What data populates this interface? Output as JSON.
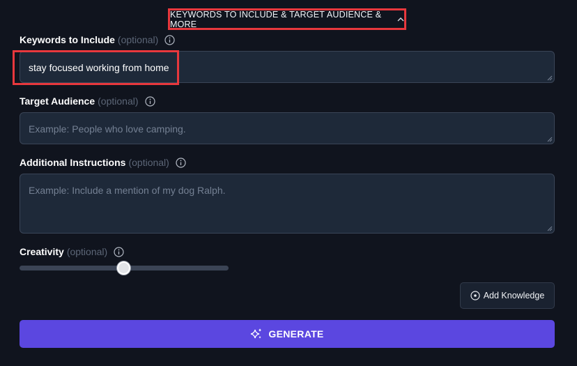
{
  "toggle": {
    "label": "KEYWORDS TO INCLUDE & TARGET AUDIENCE & MORE",
    "icon": "chevron-up-icon"
  },
  "keywords": {
    "label": "Keywords to Include",
    "optional": "(optional)",
    "value": "stay focused working from home"
  },
  "audience": {
    "label": "Target Audience",
    "optional": "(optional)",
    "placeholder": "Example: People who love camping."
  },
  "instructions": {
    "label": "Additional Instructions",
    "optional": "(optional)",
    "placeholder": "Example: Include a mention of my dog Ralph."
  },
  "creativity": {
    "label": "Creativity",
    "optional": "(optional)",
    "level": 0.5
  },
  "add_knowledge": {
    "label": "Add Knowledge",
    "icon": "plus-circle-icon"
  },
  "generate": {
    "label": "GENERATE",
    "icon": "sparkles-icon"
  },
  "colors": {
    "accent": "#5b47e0",
    "highlight": "#e8383d",
    "background": "#10141e",
    "field": "#1e2939"
  }
}
